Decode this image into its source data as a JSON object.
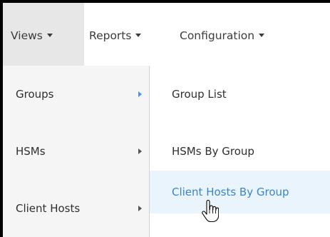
{
  "navbar": {
    "items": [
      {
        "label": "Views"
      },
      {
        "label": "Reports"
      },
      {
        "label": "Configuration"
      }
    ]
  },
  "menu": {
    "items": [
      {
        "label": "Groups",
        "active": true
      },
      {
        "label": "HSMs"
      },
      {
        "label": "Client Hosts"
      }
    ]
  },
  "submenu": {
    "items": [
      {
        "label": "Group List"
      },
      {
        "label": "HSMs By Group"
      },
      {
        "label": "Client Hosts By Group",
        "hovered": true
      }
    ]
  },
  "colors": {
    "accent": "#3b84c7",
    "hover_bg": "#eaf4fd",
    "active_nav_bg": "#e7e7e7",
    "menu_bg": "#f5f5f5"
  },
  "icons": {
    "cursor": "hand-pointer-icon"
  }
}
